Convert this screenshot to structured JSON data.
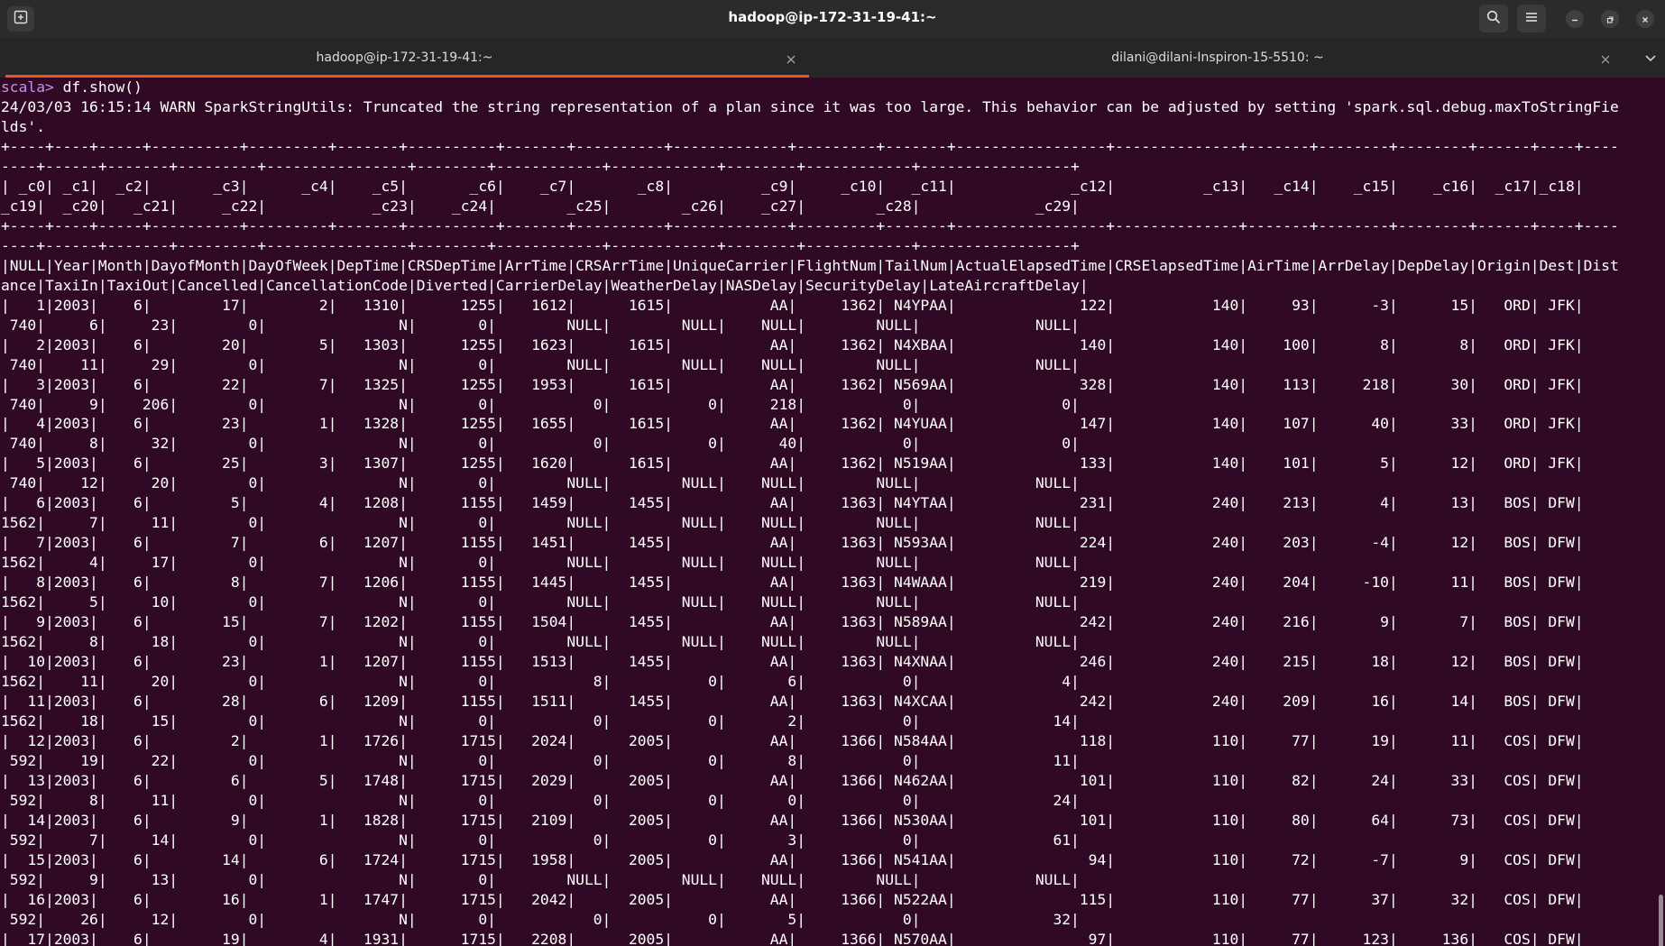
{
  "window": {
    "title": "hadoop@ip-172-31-19-41:~"
  },
  "icons": {
    "new_tab": "new-tab-icon",
    "search": "search-icon",
    "menu": "hamburger-menu-icon",
    "minimize": "minimize-icon",
    "maximize": "restore-icon",
    "close": "close-icon",
    "tab_close": "tab-close-icon",
    "tab_list": "chevron-down-icon"
  },
  "colors": {
    "terminal_bg": "#300a24",
    "prompt": "#c78ef0",
    "active_tab_accent": "#e95420"
  },
  "tabs": [
    {
      "label": "hadoop@ip-172-31-19-41:~",
      "active": true
    },
    {
      "label": "dilani@dilani-Inspiron-15-5510: ~",
      "active": false
    }
  ],
  "terminal": {
    "prompt": "scala> ",
    "command": "df.show()",
    "output_lines": [
      "24/03/03 16:15:14 WARN SparkStringUtils: Truncated the string representation of a plan since it was too large. This behavior can be adjusted by setting 'spark.sql.debug.maxToStringFie",
      "lds'.",
      "+----+----+-----+----------+---------+-------+----------+-------+----------+-------------+---------+-------+-----------------+--------------+-------+--------+--------+------+----+----",
      "----+------+-------+---------+----------------+--------+------------+------------+--------+------------+-----------------+",
      "| _c0| _c1|  _c2|       _c3|      _c4|    _c5|       _c6|    _c7|       _c8|          _c9|     _c10|   _c11|             _c12|          _c13|   _c14|    _c15|    _c16|  _c17|_c18|",
      "_c19|  _c20|   _c21|     _c22|            _c23|    _c24|        _c25|        _c26|    _c27|        _c28|             _c29|",
      "+----+----+-----+----------+---------+-------+----------+-------+----------+-------------+---------+-------+-----------------+--------------+-------+--------+--------+------+----+----",
      "----+------+-------+---------+----------------+--------+------------+------------+--------+------------+-----------------+",
      "|NULL|Year|Month|DayofMonth|DayOfWeek|DepTime|CRSDepTime|ArrTime|CRSArrTime|UniqueCarrier|FlightNum|TailNum|ActualElapsedTime|CRSElapsedTime|AirTime|ArrDelay|DepDelay|Origin|Dest|Dist",
      "ance|TaxiIn|TaxiOut|Cancelled|CancellationCode|Diverted|CarrierDelay|WeatherDelay|NASDelay|SecurityDelay|LateAircraftDelay|",
      "|   1|2003|    6|        17|        2|   1310|      1255|   1612|      1615|           AA|     1362| N4YPAA|              122|           140|     93|      -3|      15|   ORD| JFK|",
      " 740|     6|     23|        0|               N|       0|        NULL|        NULL|    NULL|        NULL|             NULL|",
      "|   2|2003|    6|        20|        5|   1303|      1255|   1623|      1615|           AA|     1362| N4XBAA|              140|           140|    100|       8|       8|   ORD| JFK|",
      " 740|    11|     29|        0|               N|       0|        NULL|        NULL|    NULL|        NULL|             NULL|",
      "|   3|2003|    6|        22|        7|   1325|      1255|   1953|      1615|           AA|     1362| N569AA|              328|           140|    113|     218|      30|   ORD| JFK|",
      " 740|     9|    206|        0|               N|       0|           0|           0|     218|           0|                0|",
      "|   4|2003|    6|        23|        1|   1328|      1255|   1655|      1615|           AA|     1362| N4YUAA|              147|           140|    107|      40|      33|   ORD| JFK|",
      " 740|     8|     32|        0|               N|       0|           0|           0|      40|           0|                0|",
      "|   5|2003|    6|        25|        3|   1307|      1255|   1620|      1615|           AA|     1362| N519AA|              133|           140|    101|       5|      12|   ORD| JFK|",
      " 740|    12|     20|        0|               N|       0|        NULL|        NULL|    NULL|        NULL|             NULL|",
      "|   6|2003|    6|         5|        4|   1208|      1155|   1459|      1455|           AA|     1363| N4YTAA|              231|           240|    213|       4|      13|   BOS| DFW|",
      "1562|     7|     11|        0|               N|       0|        NULL|        NULL|    NULL|        NULL|             NULL|",
      "|   7|2003|    6|         7|        6|   1207|      1155|   1451|      1455|           AA|     1363| N593AA|              224|           240|    203|      -4|      12|   BOS| DFW|",
      "1562|     4|     17|        0|               N|       0|        NULL|        NULL|    NULL|        NULL|             NULL|",
      "|   8|2003|    6|         8|        7|   1206|      1155|   1445|      1455|           AA|     1363| N4WAAA|              219|           240|    204|     -10|      11|   BOS| DFW|",
      "1562|     5|     10|        0|               N|       0|        NULL|        NULL|    NULL|        NULL|             NULL|",
      "|   9|2003|    6|        15|        7|   1202|      1155|   1504|      1455|           AA|     1363| N589AA|              242|           240|    216|       9|       7|   BOS| DFW|",
      "1562|     8|     18|        0|               N|       0|        NULL|        NULL|    NULL|        NULL|             NULL|",
      "|  10|2003|    6|        23|        1|   1207|      1155|   1513|      1455|           AA|     1363| N4XNAA|              246|           240|    215|      18|      12|   BOS| DFW|",
      "1562|    11|     20|        0|               N|       0|           8|           0|       6|           0|                4|",
      "|  11|2003|    6|        28|        6|   1209|      1155|   1511|      1455|           AA|     1363| N4XCAA|              242|           240|    209|      16|      14|   BOS| DFW|",
      "1562|    18|     15|        0|               N|       0|           0|           0|       2|           0|               14|",
      "|  12|2003|    6|         2|        1|   1726|      1715|   2024|      2005|           AA|     1366| N584AA|              118|           110|     77|      19|      11|   COS| DFW|",
      " 592|    19|     22|        0|               N|       0|           0|           0|       8|           0|               11|",
      "|  13|2003|    6|         6|        5|   1748|      1715|   2029|      2005|           AA|     1366| N462AA|              101|           110|     82|      24|      33|   COS| DFW|",
      " 592|     8|     11|        0|               N|       0|           0|           0|       0|           0|               24|",
      "|  14|2003|    6|         9|        1|   1828|      1715|   2109|      2005|           AA|     1366| N530AA|              101|           110|     80|      64|      73|   COS| DFW|",
      " 592|     7|     14|        0|               N|       0|           0|           0|       3|           0|               61|",
      "|  15|2003|    6|        14|        6|   1724|      1715|   1958|      2005|           AA|     1366| N541AA|               94|           110|     72|      -7|       9|   COS| DFW|",
      " 592|     9|     13|        0|               N|       0|        NULL|        NULL|    NULL|        NULL|             NULL|",
      "|  16|2003|    6|        16|        1|   1747|      1715|   2042|      2005|           AA|     1366| N522AA|              115|           110|     77|      37|      32|   COS| DFW|",
      " 592|    26|     12|        0|               N|       0|           0|           0|       5|           0|               32|",
      "|  17|2003|    6|        19|        4|   1931|      1715|   2208|      2005|           AA|     1366| N570AA|               97|           110|     77|     123|     136|   COS| DFW|"
    ]
  }
}
